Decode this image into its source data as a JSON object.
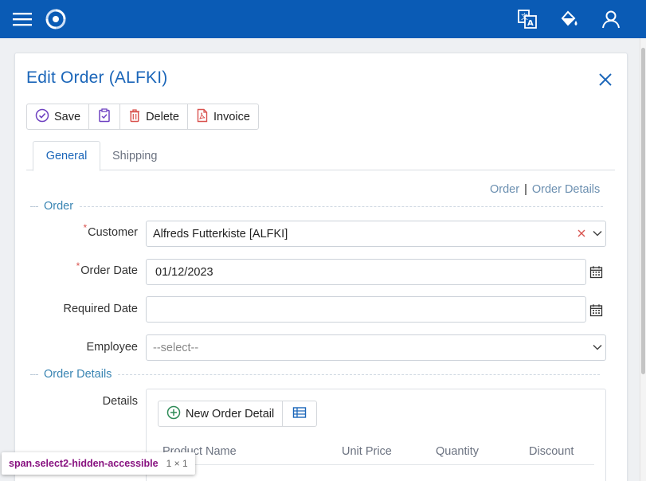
{
  "header": {
    "icons": [
      "menu-icon",
      "app-logo-icon",
      "translate-icon",
      "theme-paint-icon",
      "user-icon"
    ]
  },
  "dialog": {
    "title": "Edit Order (ALFKI)"
  },
  "toolbar": {
    "save_label": "Save",
    "delete_label": "Delete",
    "invoice_label": "Invoice"
  },
  "tabs": [
    {
      "label": "General",
      "active": true
    },
    {
      "label": "Shipping",
      "active": false
    }
  ],
  "anchors": {
    "order": "Order",
    "separator": "|",
    "order_details": "Order Details"
  },
  "sections": {
    "order": "Order",
    "order_details": "Order Details"
  },
  "form": {
    "customer": {
      "label": "Customer",
      "value": "Alfreds Futterkiste [ALFKI]",
      "required": "*"
    },
    "order_date": {
      "label": "Order Date",
      "value": "01/12/2023",
      "required": "*"
    },
    "required_date": {
      "label": "Required Date",
      "value": ""
    },
    "employee": {
      "label": "Employee",
      "placeholder": "--select--"
    },
    "details": {
      "label": "Details"
    }
  },
  "details_grid": {
    "new_button": "New Order Detail",
    "columns": [
      "Product Name",
      "Unit Price",
      "Quantity",
      "Discount"
    ]
  },
  "inspector_tooltip": {
    "selector": "span.select2-hidden-accessible",
    "size": "1 × 1"
  },
  "colors": {
    "header_bg": "#0a5bb5",
    "accent": "#1b66b9",
    "section_title": "#3a85b3",
    "required": "#d9534f",
    "delete_icon": "#d9534f"
  }
}
